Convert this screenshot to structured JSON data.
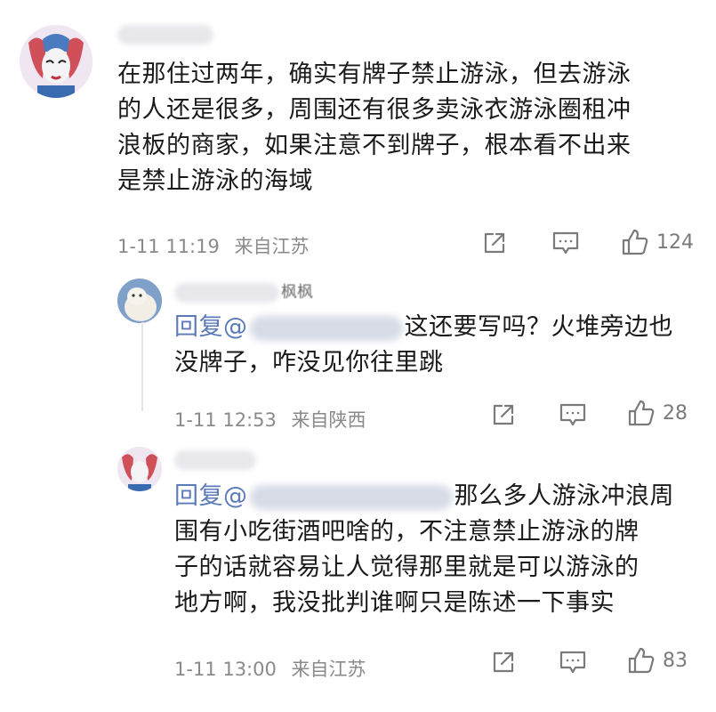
{
  "comments": [
    {
      "lines": [
        "在那住过两年，确实有牌子禁止游泳，但去游泳",
        "的人还是很多，周围还有很多卖泳衣游泳圈租冲",
        "浪板的商家，如果注意不到牌子，根本看不出来",
        "是禁止游泳的海域"
      ],
      "time": "1-11 11:19",
      "location": "来自江苏",
      "likes": "124"
    },
    {
      "name_visible": "枫枫",
      "reply_prefix": "回复@",
      "line1_rest": "这还要写吗？火堆旁边也",
      "line2": "没牌子，咋没见你往里跳",
      "time": "1-11 12:53",
      "location": "来自陕西",
      "likes": "28"
    },
    {
      "reply_prefix": "回复@",
      "line1_rest": "那么多人游泳冲浪周",
      "lines_rest": [
        "围有小吃街酒吧啥的，不注意禁止游泳的牌",
        "子的话就容易让人觉得那里就是可以游泳的",
        "地方啊，我没批判谁啊只是陈述一下事实"
      ],
      "time": "1-11 13:00",
      "location": "来自江苏",
      "likes": "83"
    }
  ],
  "icons": [
    "share-icon",
    "comment-icon",
    "like-icon"
  ],
  "colors": {
    "mention": "#5a7ab8",
    "meta": "#8a8a8a",
    "text": "#1a1a1a"
  }
}
